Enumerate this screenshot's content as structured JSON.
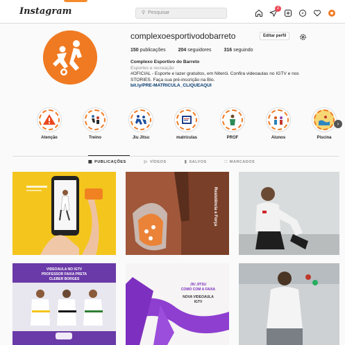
{
  "header": {
    "brand": "Instagram",
    "search_placeholder": "Pesquisar",
    "notification_count": "2"
  },
  "profile": {
    "username": "complexoesportivodobarreto",
    "edit_label": "Editar perfil",
    "stats": [
      {
        "value": "150",
        "label": "publicações"
      },
      {
        "value": "204",
        "label": "seguidores"
      },
      {
        "value": "316",
        "label": "seguindo"
      }
    ],
    "display_name": "Complexo Esportivo do Barreto",
    "category": "Esportes e recreação",
    "bio_line1": "#OFICIAL - Esporte e lazer gratuitos, em Niterói. Confira videoaulas no IGTV e nos",
    "bio_line2": "STORIES. Faça sua pré-inscrição na Bio.",
    "link": "bit.ly/PRE-MATRICULA_CLIQUEAQUI"
  },
  "highlights": [
    {
      "label": "Atenção",
      "icon": "warning-icon"
    },
    {
      "label": "Treino",
      "icon": "training-icon"
    },
    {
      "label": "Jiu Jitsu",
      "icon": "jiujitsu-icon"
    },
    {
      "label": "matrículas",
      "icon": "registration-icon"
    },
    {
      "label": "PROF",
      "icon": "teacher-icon"
    },
    {
      "label": "Alunos",
      "icon": "students-icon"
    },
    {
      "label": "Piscina",
      "icon": "pool-icon"
    }
  ],
  "tabs": [
    {
      "label": "PUBLICAÇÕES",
      "icon": "grid-icon",
      "active": true
    },
    {
      "label": "VÍDEOS",
      "icon": "video-icon",
      "active": false
    },
    {
      "label": "SALVOS",
      "icon": "bookmark-icon",
      "active": false
    },
    {
      "label": "MARCADOS",
      "icon": "tag-icon",
      "active": false
    }
  ],
  "posts": {
    "p2_text": "Resistência e Força",
    "p4_line1": "VIDEOAULA NO IGTV",
    "p4_line2": "PROFESSOR FAIXA PRETA",
    "p4_line3": "CLEBER BORGES",
    "p5_line1": "JIU JITSU",
    "p5_line2": "COMO COM A FAIXA",
    "p5_line3": "NOVA VIDEOAULA",
    "p5_line4": "IGTV"
  },
  "colors": {
    "brand_orange": "#f07a22",
    "link_blue": "#00376b",
    "badge_red": "#ed4956"
  }
}
